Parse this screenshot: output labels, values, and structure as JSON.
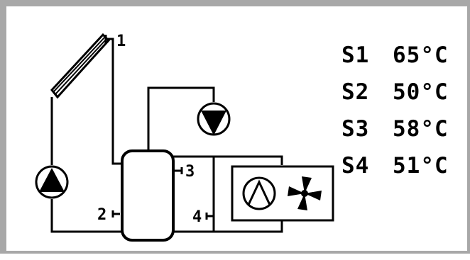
{
  "sensors": [
    {
      "id": "S1",
      "value": "65°C"
    },
    {
      "id": "S2",
      "value": "50°C"
    },
    {
      "id": "S3",
      "value": "58°C"
    },
    {
      "id": "S4",
      "value": "51°C"
    }
  ],
  "diagram": {
    "sensor_markers": [
      "1",
      "2",
      "3",
      "4"
    ],
    "components": [
      "solar-collector",
      "collector-pump",
      "storage-tank",
      "circulation-pump",
      "heating-circuit-pump",
      "heat-exchanger-fan"
    ]
  },
  "colors": {
    "frame": "#a8a8a8",
    "ink": "#000000",
    "background": "#ffffff"
  }
}
